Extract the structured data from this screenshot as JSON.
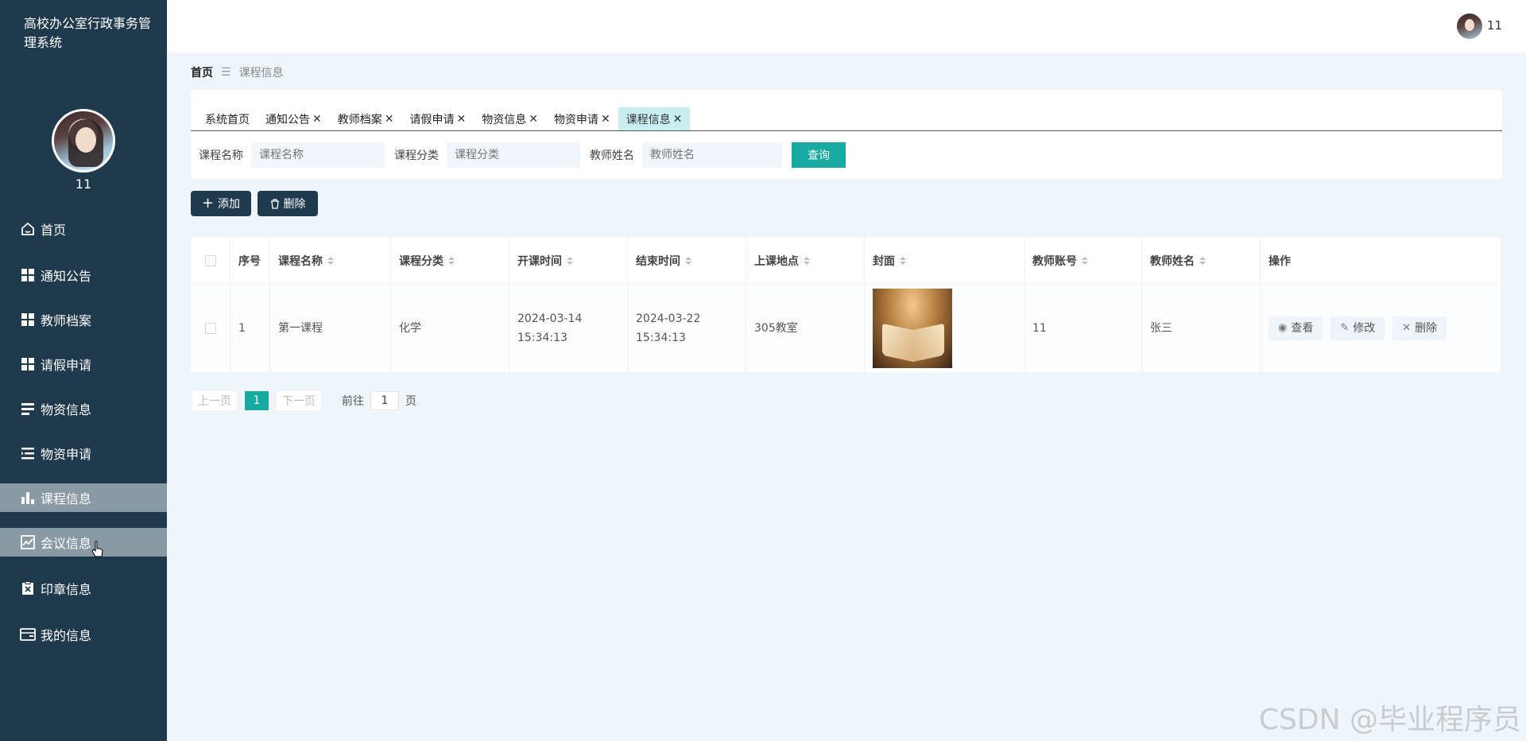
{
  "app": {
    "title": "高校办公室行政事务管理系统"
  },
  "sidebar": {
    "user_name": "11",
    "items": [
      {
        "label": "首页",
        "icon": "home-icon"
      },
      {
        "label": "通知公告",
        "icon": "grid-icon"
      },
      {
        "label": "教师档案",
        "icon": "grid-icon"
      },
      {
        "label": "请假申请",
        "icon": "grid-icon"
      },
      {
        "label": "物资信息",
        "icon": "list-icon"
      },
      {
        "label": "物资申请",
        "icon": "indent-list-icon"
      },
      {
        "label": "课程信息",
        "icon": "bar-chart-icon",
        "active": true
      },
      {
        "label": "会议信息",
        "icon": "line-chart-icon",
        "hover": true
      },
      {
        "label": "印章信息",
        "icon": "clipboard-x-icon"
      },
      {
        "label": "我的信息",
        "icon": "wallet-icon"
      }
    ]
  },
  "header": {
    "user_name": "11"
  },
  "breadcrumb": {
    "home": "首页",
    "separator": "☰",
    "current": "课程信息"
  },
  "tabs": [
    {
      "label": "系统首页",
      "closable": false
    },
    {
      "label": "通知公告",
      "closable": true
    },
    {
      "label": "教师档案",
      "closable": true
    },
    {
      "label": "请假申请",
      "closable": true
    },
    {
      "label": "物资信息",
      "closable": true
    },
    {
      "label": "物资申请",
      "closable": true
    },
    {
      "label": "课程信息",
      "closable": true,
      "active": true
    }
  ],
  "tab_close_glyph": "✕",
  "search": {
    "fields": [
      {
        "label": "课程名称",
        "placeholder": "课程名称"
      },
      {
        "label": "课程分类",
        "placeholder": "课程分类"
      },
      {
        "label": "教师姓名",
        "placeholder": "教师姓名"
      }
    ],
    "button": "查询"
  },
  "actions": {
    "add": "添加",
    "delete": "删除"
  },
  "table": {
    "columns": [
      "序号",
      "课程名称",
      "课程分类",
      "开课时间",
      "结束时间",
      "上课地点",
      "封面",
      "教师账号",
      "教师姓名",
      "操作"
    ],
    "rows": [
      {
        "index": "1",
        "course_name": "第一课程",
        "category": "化学",
        "start_time": "2024-03-14 15:34:13",
        "end_time": "2024-03-22 15:34:13",
        "location": "305教室",
        "teacher_account": "11",
        "teacher_name": "张三"
      }
    ],
    "row_actions": {
      "view": "查看",
      "edit": "修改",
      "delete": "删除"
    }
  },
  "pagination": {
    "prev": "上一页",
    "current": "1",
    "next": "下一页",
    "goto": "前往",
    "goto_value": "1",
    "page_suffix": "页"
  },
  "watermark": "CSDN @毕业程序员",
  "colors": {
    "sidebar_bg": "#1f3a4d",
    "accent": "#16aaa0",
    "active_tab": "#c8eef2",
    "page_bg": "#eef6fc"
  }
}
